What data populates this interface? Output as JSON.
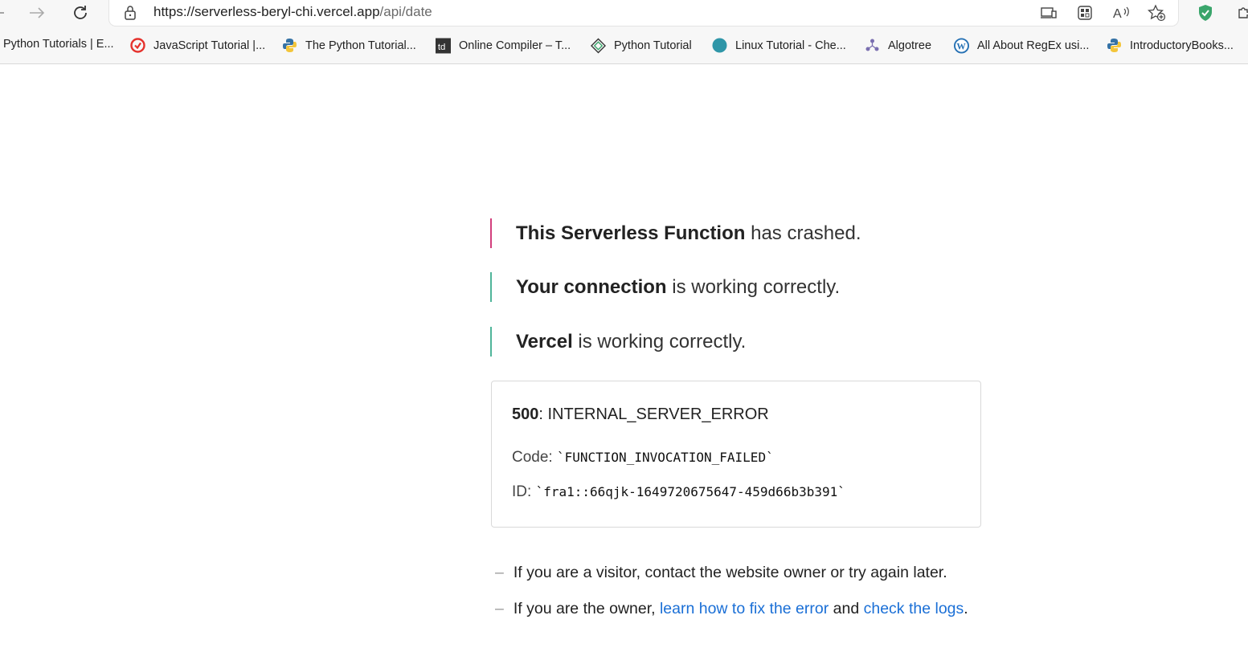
{
  "browser": {
    "url_host": "https://serverless-beryl-chi.vercel.app",
    "url_path": "/api/date",
    "shield_color": "#3aa56b"
  },
  "bookmarks": [
    {
      "label": "Python Tutorials | E...",
      "icon": "none"
    },
    {
      "label": "JavaScript Tutorial |...",
      "icon": "red-logo-icon"
    },
    {
      "label": "The Python Tutorial...",
      "icon": "python-icon"
    },
    {
      "label": "Online Compiler – T...",
      "icon": "td-icon"
    },
    {
      "label": "Python Tutorial",
      "icon": "diamond-logo-icon"
    },
    {
      "label": "Linux Tutorial - Che...",
      "icon": "teal-circle-icon"
    },
    {
      "label": "Algotree",
      "icon": "tree-icon"
    },
    {
      "label": "All About RegEx usi...",
      "icon": "wordpress-icon"
    },
    {
      "label": "IntroductoryBooks...",
      "icon": "python-icon"
    }
  ],
  "status": {
    "crash_bold": "This Serverless Function",
    "crash_rest": " has crashed.",
    "connection_bold": "Your connection",
    "connection_rest": " is working correctly.",
    "vercel_bold": "Vercel",
    "vercel_rest": " is working correctly.",
    "crash_color": "#d23f7c",
    "ok_color": "#50b59a"
  },
  "error": {
    "code_num": "500",
    "code_text": ": INTERNAL_SERVER_ERROR",
    "code_label": "Code: ",
    "code_value": "`FUNCTION_INVOCATION_FAILED`",
    "id_label": "ID: ",
    "id_value": "`fra1::66qjk-1649720675647-459d66b3b391`"
  },
  "notes": {
    "dash": "–",
    "visitor": "If you are a visitor, contact the website owner or try again later.",
    "owner_prefix": "If you are the owner, ",
    "fix_link": "learn how to fix the error",
    "and": " and ",
    "logs_link": "check the logs",
    "period": "."
  },
  "link_color": "#1a6fd6"
}
